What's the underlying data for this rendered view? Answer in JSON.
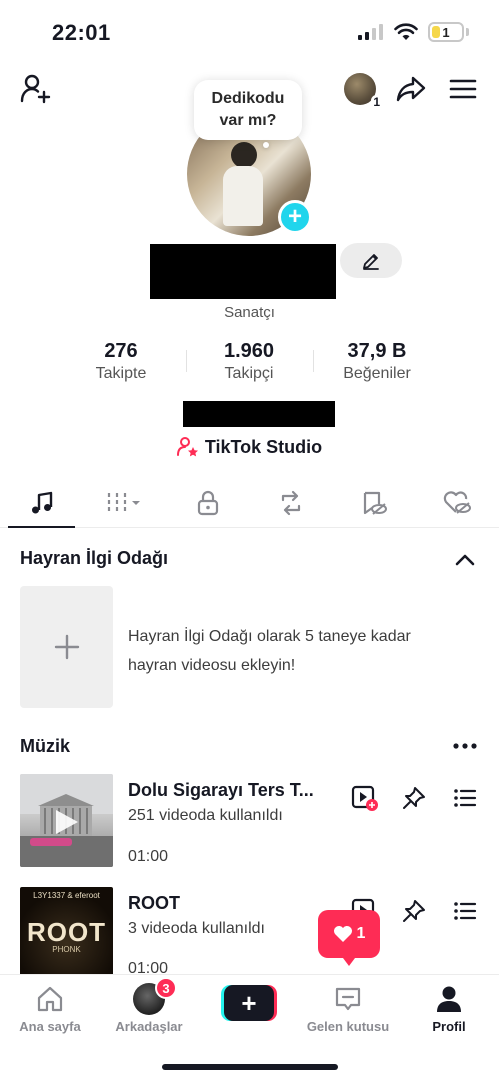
{
  "status_bar": {
    "time": "22:01",
    "battery_level": "1"
  },
  "header": {
    "bubble_text": "Dedikodu var mı?",
    "mini_avatar_badge": "1",
    "category": "Sanatçı"
  },
  "stats": [
    {
      "value": "276",
      "label": "Takipte"
    },
    {
      "value": "1.960",
      "label": "Takipçi"
    },
    {
      "value": "37,9 B",
      "label": "Beğeniler"
    }
  ],
  "studio": {
    "label": "TikTok Studio"
  },
  "tabs": [
    {
      "icon": "music-note-icon",
      "active": true
    },
    {
      "icon": "grid-filter-icon",
      "active": false
    },
    {
      "icon": "lock-icon",
      "active": false
    },
    {
      "icon": "repost-icon",
      "active": false
    },
    {
      "icon": "hidden-favorite-icon",
      "active": false
    },
    {
      "icon": "liked-hidden-icon",
      "active": false
    }
  ],
  "fan_spotlight": {
    "title": "Hayran İlgi Odağı",
    "description": "Hayran İlgi Odağı olarak 5 taneye kadar hayran videosu ekleyin!"
  },
  "music": {
    "title": "Müzik",
    "songs": [
      {
        "title": "Dolu Sigarayı Ters T...",
        "usage": "251 videoda kullanıldı",
        "duration": "01:00"
      },
      {
        "title": "ROOT",
        "usage": "3 videoda kullanıldı",
        "duration": "01:00",
        "thumb_artist": "L3Y1337 & eferoot",
        "thumb_title": "ROOT",
        "thumb_sub": "PHONK"
      }
    ]
  },
  "floating": {
    "likes_count": "1"
  },
  "bottom_nav": {
    "home": "Ana sayfa",
    "friends": "Arkadaşlar",
    "friends_badge": "3",
    "inbox": "Gelen kutusu",
    "profile": "Profil"
  },
  "colors": {
    "accent": "#fe2c55",
    "cyan": "#20d5ec",
    "text": "#161823"
  }
}
